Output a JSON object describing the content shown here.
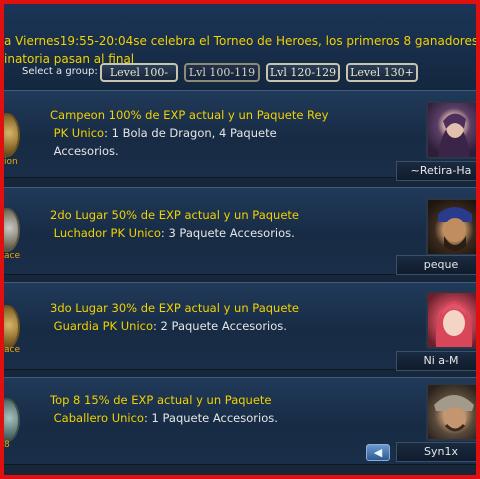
{
  "announcement": {
    "line1": "a Viernes19:55-20:04se celebra el Torneo de Heroes, los primeros 8 ganadores de la",
    "line2": "inatoria pasan al final"
  },
  "group_selector": {
    "label": "Select a group:",
    "buttons": [
      {
        "label": "Level 100-",
        "active": false
      },
      {
        "label": "Lvl 100-119",
        "active": true
      },
      {
        "label": "Lvl 120-129",
        "active": false
      },
      {
        "label": "Level 130+",
        "active": false
      }
    ]
  },
  "rewards": [
    {
      "medal_label": "ion",
      "line1": "Campeon  100% de EXP actual y un Paquete Rey",
      "line2_rank": "PK Unico",
      "line2_rest": ": 1 Bola de Dragon, 4 Paquete",
      "line3": "Accesorios.",
      "player_name": "~Retira-Ha"
    },
    {
      "medal_label": "ace",
      "line1": "2do Lugar 50% de EXP actual y un Paquete",
      "line2_rank": "Luchador PK Unico",
      "line2_rest": ": 3 Paquete Accesorios.",
      "line3": "",
      "player_name": "peque"
    },
    {
      "medal_label": "ace",
      "line1": "3do Lugar 30% de EXP actual y un Paquete",
      "line2_rank": "Guardia PK Unico",
      "line2_rest": ": 2 Paquete Accesorios.",
      "line3": "",
      "player_name": "Ni    a-M"
    },
    {
      "medal_label": "8",
      "line1": "Top 8     15% de EXP actual y un Paquete",
      "line2_rank": "Caballero Unico",
      "line2_rest": ": 1 Paquete Accesorios.",
      "line3": "",
      "player_name": "Syn1x"
    }
  ],
  "back_button": {
    "icon": "back-arrow-icon",
    "glyph": "◀"
  },
  "colors": {
    "frame": "#e01010",
    "highlight": "#f2d200",
    "text": "#e6e6e6"
  }
}
